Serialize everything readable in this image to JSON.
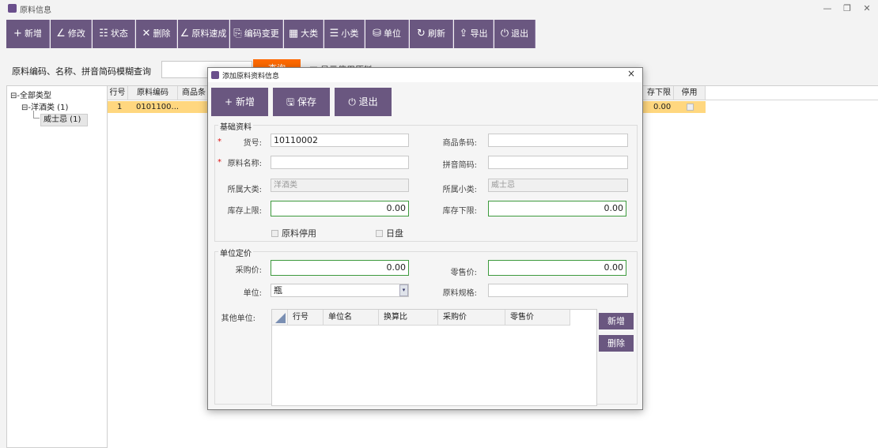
{
  "window": {
    "title": "原料信息",
    "minimize": "—",
    "restore": "❐",
    "close": "✕"
  },
  "toolbar": [
    {
      "icon": "+",
      "label": "新增"
    },
    {
      "icon": "∠",
      "label": "修改"
    },
    {
      "icon": "☷",
      "label": "状态"
    },
    {
      "icon": "✕",
      "label": "删除"
    },
    {
      "icon": "∠",
      "label": "原料速成"
    },
    {
      "icon": "⎘",
      "label": "编码变更"
    },
    {
      "icon": "▦",
      "label": "大类"
    },
    {
      "icon": "☰",
      "label": "小类"
    },
    {
      "icon": "⛁",
      "label": "单位"
    },
    {
      "icon": "↻",
      "label": "刷新"
    },
    {
      "icon": "⇪",
      "label": "导出"
    },
    {
      "icon": "⏻",
      "label": "退出"
    }
  ],
  "search": {
    "label": "原料编码、名称、拼音简码模糊查询",
    "value": "",
    "button": "查询",
    "show_disabled": "显示停用原料"
  },
  "tree": {
    "root": "全部类型",
    "category": "洋酒类 (1)",
    "subcategory": "威士忌 (1)"
  },
  "grid": {
    "headers": [
      "行号",
      "原料编码",
      "商品条",
      "存下限",
      "停用"
    ],
    "row": {
      "no": "1",
      "code": "0101100...",
      "min": "0.00"
    }
  },
  "dialog": {
    "title": "添加原料资料信息",
    "close": "×",
    "buttons": [
      {
        "icon": "+",
        "label": "新增"
      },
      {
        "icon": "🖫",
        "label": "保存"
      },
      {
        "icon": "⏻",
        "label": "退出"
      }
    ],
    "basic": {
      "group": "基础资料",
      "code_label": "货号:",
      "code_value": "10110002",
      "barcode_label": "商品条码:",
      "barcode_value": "",
      "name_label": "原料名称:",
      "name_value": "",
      "pinyin_label": "拼音简码:",
      "pinyin_value": "",
      "major_label": "所属大类:",
      "major_value": "洋酒类",
      "minor_label": "所属小类:",
      "minor_value": "威士忌",
      "max_label": "库存上限:",
      "max_value": "0.00",
      "min_label": "库存下限:",
      "min_value": "0.00",
      "disabled_label": "原料停用",
      "daily_label": "日盘"
    },
    "pricing": {
      "group": "单位定价",
      "purchase_label": "采购价:",
      "purchase_value": "0.00",
      "retail_label": "零售价:",
      "retail_value": "0.00",
      "unit_label": "单位:",
      "unit_value": "瓶",
      "spec_label": "原料规格:",
      "spec_value": "",
      "other_label": "其他单位:",
      "other_headers": [
        "行号",
        "单位名",
        "换算比",
        "采购价",
        "零售价"
      ],
      "add_button": "新增",
      "delete_button": "删除"
    }
  }
}
